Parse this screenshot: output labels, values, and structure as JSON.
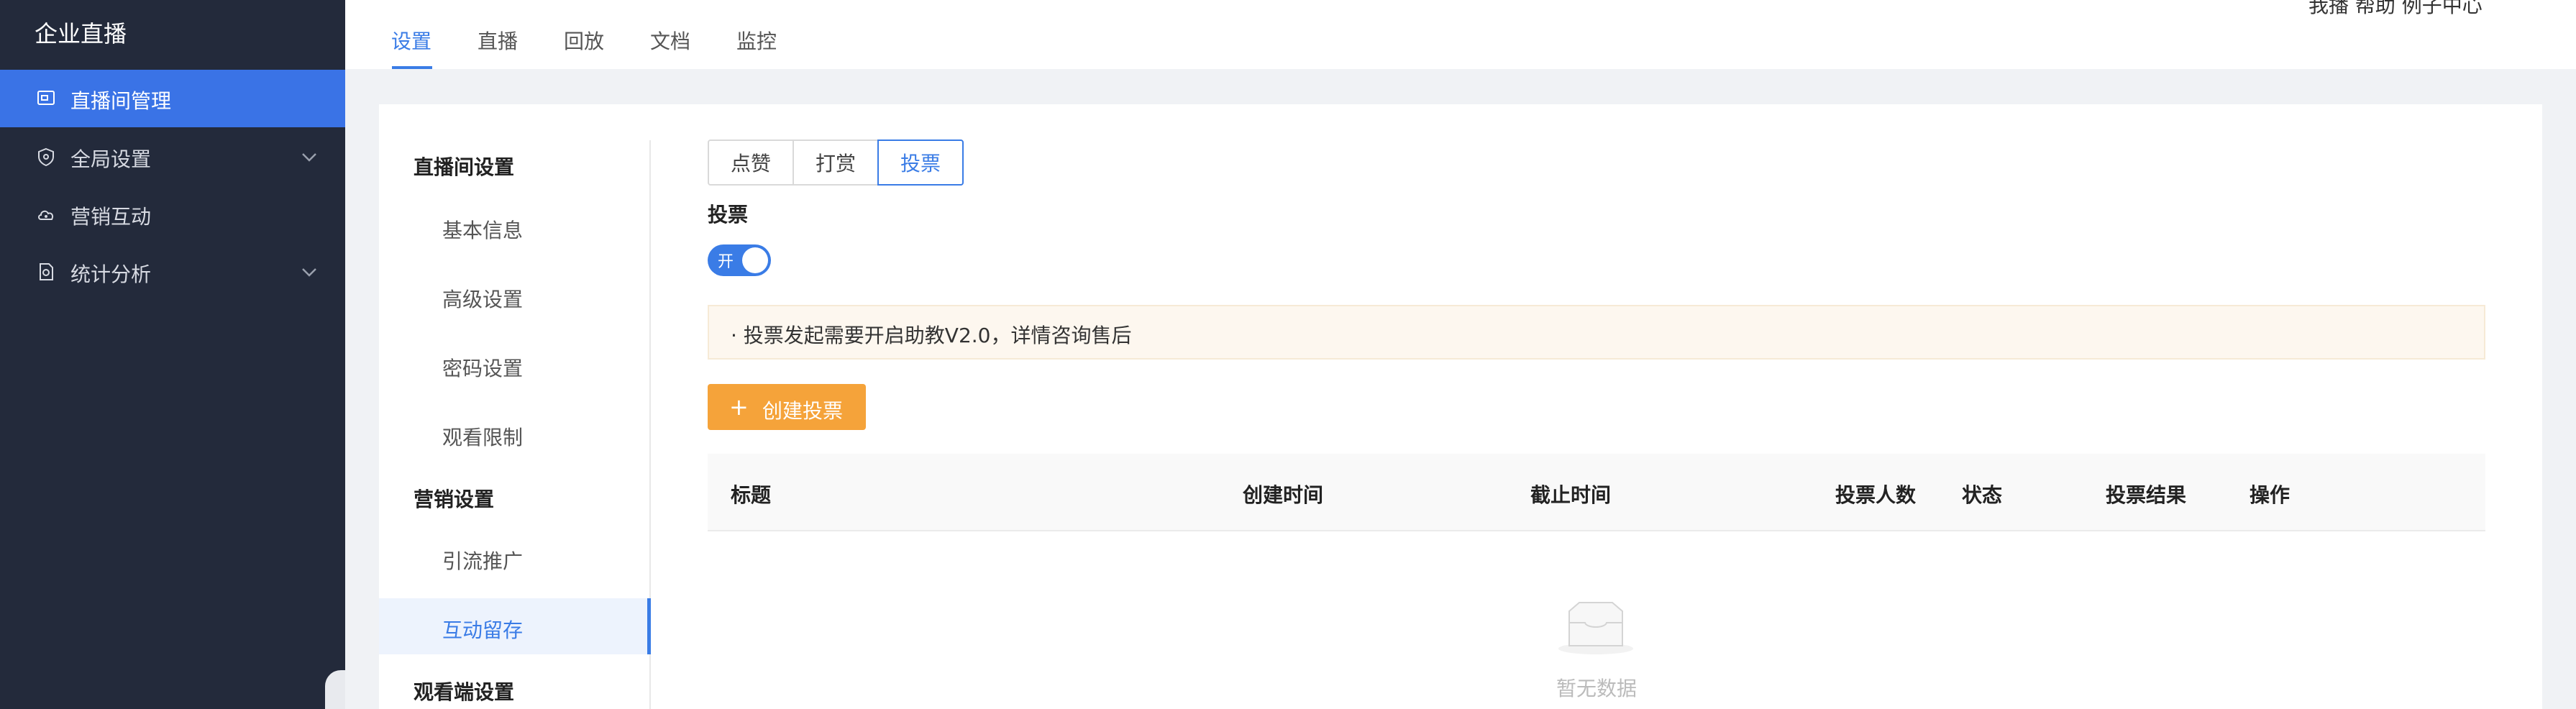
{
  "app": {
    "title": "企业直播"
  },
  "sidebar": {
    "items": [
      {
        "label": "直播间管理",
        "icon": "monitor-icon",
        "active": true
      },
      {
        "label": "全局设置",
        "icon": "shield-icon",
        "has_chevron": true
      },
      {
        "label": "营销互动",
        "icon": "cloud-icon"
      },
      {
        "label": "统计分析",
        "icon": "report-icon",
        "has_chevron": true
      }
    ]
  },
  "header": {
    "tabs": [
      {
        "label": "设置",
        "active": true
      },
      {
        "label": "直播"
      },
      {
        "label": "回放"
      },
      {
        "label": "文档"
      },
      {
        "label": "监控"
      }
    ],
    "user_fragment": "我播  帮助  例子中心"
  },
  "subnav": {
    "groups": [
      {
        "title": "直播间设置",
        "items": [
          "基本信息",
          "高级设置",
          "密码设置",
          "观看限制"
        ]
      },
      {
        "title": "营销设置",
        "items": [
          "引流推广",
          "互动留存"
        ]
      },
      {
        "title": "观看端设置",
        "items": []
      }
    ],
    "active_item": "互动留存"
  },
  "main": {
    "segments": [
      {
        "label": "点赞"
      },
      {
        "label": "打赏"
      },
      {
        "label": "投票",
        "active": true
      }
    ],
    "section_title": "投票",
    "toggle": {
      "label": "开",
      "on": true
    },
    "notice": "· 投票发起需要开启助教V2.0，详情咨询售后",
    "create_button": {
      "icon": "plus-icon",
      "label": "创建投票"
    },
    "table": {
      "columns": [
        "标题",
        "创建时间",
        "截止时间",
        "投票人数",
        "状态",
        "投票结果",
        "操作"
      ],
      "rows": [],
      "empty_text": "暂无数据",
      "empty_icon": "inbox-icon"
    }
  },
  "colors": {
    "accent": "#3a7ce6",
    "sidebar_bg": "#232a3b",
    "primary_action": "#f5a33a",
    "notice_bg": "#fdf7ef"
  }
}
